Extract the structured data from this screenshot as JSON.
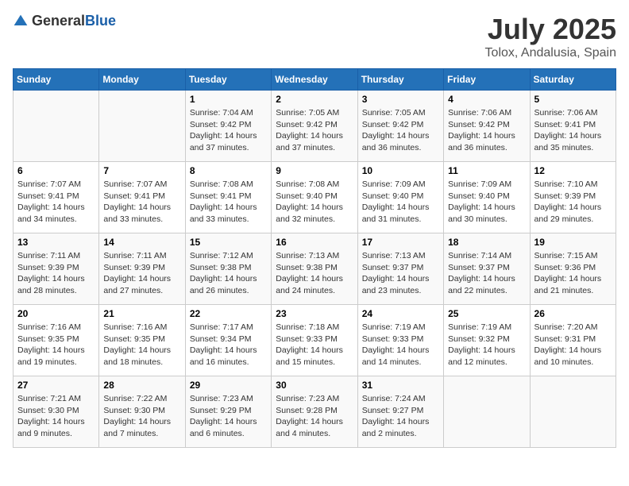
{
  "header": {
    "logo_general": "General",
    "logo_blue": "Blue",
    "month_year": "July 2025",
    "location": "Tolox, Andalusia, Spain"
  },
  "weekdays": [
    "Sunday",
    "Monday",
    "Tuesday",
    "Wednesday",
    "Thursday",
    "Friday",
    "Saturday"
  ],
  "weeks": [
    [
      {
        "day": "",
        "empty": true
      },
      {
        "day": "",
        "empty": true
      },
      {
        "day": "1",
        "sunrise": "Sunrise: 7:04 AM",
        "sunset": "Sunset: 9:42 PM",
        "daylight": "Daylight: 14 hours and 37 minutes."
      },
      {
        "day": "2",
        "sunrise": "Sunrise: 7:05 AM",
        "sunset": "Sunset: 9:42 PM",
        "daylight": "Daylight: 14 hours and 37 minutes."
      },
      {
        "day": "3",
        "sunrise": "Sunrise: 7:05 AM",
        "sunset": "Sunset: 9:42 PM",
        "daylight": "Daylight: 14 hours and 36 minutes."
      },
      {
        "day": "4",
        "sunrise": "Sunrise: 7:06 AM",
        "sunset": "Sunset: 9:42 PM",
        "daylight": "Daylight: 14 hours and 36 minutes."
      },
      {
        "day": "5",
        "sunrise": "Sunrise: 7:06 AM",
        "sunset": "Sunset: 9:41 PM",
        "daylight": "Daylight: 14 hours and 35 minutes."
      }
    ],
    [
      {
        "day": "6",
        "sunrise": "Sunrise: 7:07 AM",
        "sunset": "Sunset: 9:41 PM",
        "daylight": "Daylight: 14 hours and 34 minutes."
      },
      {
        "day": "7",
        "sunrise": "Sunrise: 7:07 AM",
        "sunset": "Sunset: 9:41 PM",
        "daylight": "Daylight: 14 hours and 33 minutes."
      },
      {
        "day": "8",
        "sunrise": "Sunrise: 7:08 AM",
        "sunset": "Sunset: 9:41 PM",
        "daylight": "Daylight: 14 hours and 33 minutes."
      },
      {
        "day": "9",
        "sunrise": "Sunrise: 7:08 AM",
        "sunset": "Sunset: 9:40 PM",
        "daylight": "Daylight: 14 hours and 32 minutes."
      },
      {
        "day": "10",
        "sunrise": "Sunrise: 7:09 AM",
        "sunset": "Sunset: 9:40 PM",
        "daylight": "Daylight: 14 hours and 31 minutes."
      },
      {
        "day": "11",
        "sunrise": "Sunrise: 7:09 AM",
        "sunset": "Sunset: 9:40 PM",
        "daylight": "Daylight: 14 hours and 30 minutes."
      },
      {
        "day": "12",
        "sunrise": "Sunrise: 7:10 AM",
        "sunset": "Sunset: 9:39 PM",
        "daylight": "Daylight: 14 hours and 29 minutes."
      }
    ],
    [
      {
        "day": "13",
        "sunrise": "Sunrise: 7:11 AM",
        "sunset": "Sunset: 9:39 PM",
        "daylight": "Daylight: 14 hours and 28 minutes."
      },
      {
        "day": "14",
        "sunrise": "Sunrise: 7:11 AM",
        "sunset": "Sunset: 9:39 PM",
        "daylight": "Daylight: 14 hours and 27 minutes."
      },
      {
        "day": "15",
        "sunrise": "Sunrise: 7:12 AM",
        "sunset": "Sunset: 9:38 PM",
        "daylight": "Daylight: 14 hours and 26 minutes."
      },
      {
        "day": "16",
        "sunrise": "Sunrise: 7:13 AM",
        "sunset": "Sunset: 9:38 PM",
        "daylight": "Daylight: 14 hours and 24 minutes."
      },
      {
        "day": "17",
        "sunrise": "Sunrise: 7:13 AM",
        "sunset": "Sunset: 9:37 PM",
        "daylight": "Daylight: 14 hours and 23 minutes."
      },
      {
        "day": "18",
        "sunrise": "Sunrise: 7:14 AM",
        "sunset": "Sunset: 9:37 PM",
        "daylight": "Daylight: 14 hours and 22 minutes."
      },
      {
        "day": "19",
        "sunrise": "Sunrise: 7:15 AM",
        "sunset": "Sunset: 9:36 PM",
        "daylight": "Daylight: 14 hours and 21 minutes."
      }
    ],
    [
      {
        "day": "20",
        "sunrise": "Sunrise: 7:16 AM",
        "sunset": "Sunset: 9:35 PM",
        "daylight": "Daylight: 14 hours and 19 minutes."
      },
      {
        "day": "21",
        "sunrise": "Sunrise: 7:16 AM",
        "sunset": "Sunset: 9:35 PM",
        "daylight": "Daylight: 14 hours and 18 minutes."
      },
      {
        "day": "22",
        "sunrise": "Sunrise: 7:17 AM",
        "sunset": "Sunset: 9:34 PM",
        "daylight": "Daylight: 14 hours and 16 minutes."
      },
      {
        "day": "23",
        "sunrise": "Sunrise: 7:18 AM",
        "sunset": "Sunset: 9:33 PM",
        "daylight": "Daylight: 14 hours and 15 minutes."
      },
      {
        "day": "24",
        "sunrise": "Sunrise: 7:19 AM",
        "sunset": "Sunset: 9:33 PM",
        "daylight": "Daylight: 14 hours and 14 minutes."
      },
      {
        "day": "25",
        "sunrise": "Sunrise: 7:19 AM",
        "sunset": "Sunset: 9:32 PM",
        "daylight": "Daylight: 14 hours and 12 minutes."
      },
      {
        "day": "26",
        "sunrise": "Sunrise: 7:20 AM",
        "sunset": "Sunset: 9:31 PM",
        "daylight": "Daylight: 14 hours and 10 minutes."
      }
    ],
    [
      {
        "day": "27",
        "sunrise": "Sunrise: 7:21 AM",
        "sunset": "Sunset: 9:30 PM",
        "daylight": "Daylight: 14 hours and 9 minutes."
      },
      {
        "day": "28",
        "sunrise": "Sunrise: 7:22 AM",
        "sunset": "Sunset: 9:30 PM",
        "daylight": "Daylight: 14 hours and 7 minutes."
      },
      {
        "day": "29",
        "sunrise": "Sunrise: 7:23 AM",
        "sunset": "Sunset: 9:29 PM",
        "daylight": "Daylight: 14 hours and 6 minutes."
      },
      {
        "day": "30",
        "sunrise": "Sunrise: 7:23 AM",
        "sunset": "Sunset: 9:28 PM",
        "daylight": "Daylight: 14 hours and 4 minutes."
      },
      {
        "day": "31",
        "sunrise": "Sunrise: 7:24 AM",
        "sunset": "Sunset: 9:27 PM",
        "daylight": "Daylight: 14 hours and 2 minutes."
      },
      {
        "day": "",
        "empty": true
      },
      {
        "day": "",
        "empty": true
      }
    ]
  ]
}
